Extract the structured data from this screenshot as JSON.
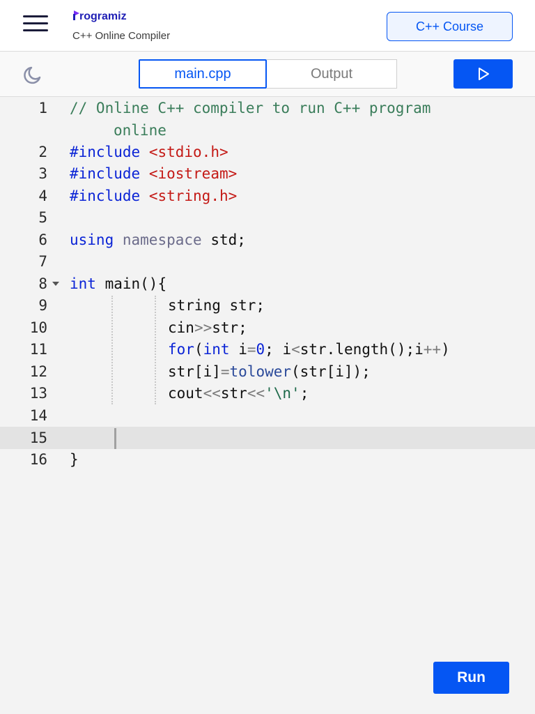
{
  "header": {
    "brand": "rogramiz",
    "subtitle": "C++ Online Compiler",
    "course_button": "C++ Course"
  },
  "toolbar": {
    "tabs": [
      {
        "label": "main.cpp",
        "active": true
      },
      {
        "label": "Output",
        "active": false
      }
    ],
    "theme_icon": "moon-icon",
    "run_icon": "play-icon"
  },
  "editor": {
    "line_numbers": [
      "1",
      "2",
      "3",
      "4",
      "5",
      "6",
      "7",
      "8",
      "9",
      "10",
      "11",
      "12",
      "13",
      "14",
      "15",
      "16"
    ],
    "active_line": "15",
    "code": {
      "l1a": "// Online C++ compiler to run C++ program",
      "l1b": "online",
      "l2_kw": "#include",
      "l2_str": "<stdio.h>",
      "l3_kw": "#include",
      "l3_str": "<iostream>",
      "l4_kw": "#include",
      "l4_str": "<string.h>",
      "l6_kw": "using",
      "l6_ns": "namespace",
      "l6_rest": "std;",
      "l8_kw": "int",
      "l8_rest": "main(){",
      "l9": "string str;",
      "l10_a": "cin",
      "l10_op": ">>",
      "l10_b": "str;",
      "l11_for": "for",
      "l11_p1": "(",
      "l11_int": "int",
      "l11_i": "i",
      "l11_eq": "=",
      "l11_zero": "0",
      "l11_mid": "; i",
      "l11_lt": "<",
      "l11_rest": "str.length();i",
      "l11_pp": "++",
      "l11_end": ")",
      "l12_a": "str[i]",
      "l12_eq": "=",
      "l12_fn": "tolower",
      "l12_rest": "(str[i]);",
      "l13_a": "cout",
      "l13_op1": "<<",
      "l13_b": "str",
      "l13_op2": "<<",
      "l13_chr": "'\\n'",
      "l13_end": ";",
      "l16": "}"
    }
  },
  "run_button": "Run",
  "colors": {
    "accent": "#0556f3",
    "brand": "#1f1fb5"
  }
}
